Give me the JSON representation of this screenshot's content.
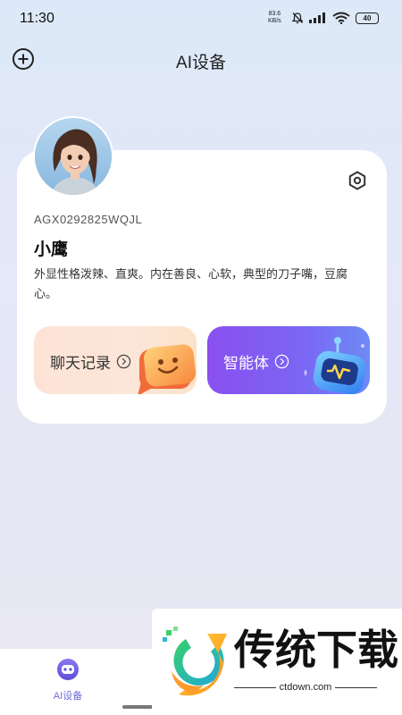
{
  "status_bar": {
    "time": "11:30",
    "net_speed_value": "83.6",
    "net_speed_unit": "KB/s",
    "battery": "40"
  },
  "header": {
    "title": "AI设备"
  },
  "card": {
    "device_id": "AGX0292825WQJL",
    "name": "小鹰",
    "description": "外显性格泼辣、直爽。内在善良、心软，典型的刀子嘴，豆腐心。",
    "chat_button_label": "聊天记录",
    "agent_button_label": "智能体"
  },
  "bottom_nav": {
    "items": [
      {
        "label": "AI设备",
        "icon": "robot-icon",
        "active": true
      }
    ]
  },
  "watermark": {
    "text": "传统下载",
    "sub": "ctdown.com"
  },
  "colors": {
    "accent": "#6b6bd8",
    "agent_button_start": "#8a4ff0",
    "agent_button_end": "#6d8bf5",
    "chat_button": "#fde3d6"
  }
}
